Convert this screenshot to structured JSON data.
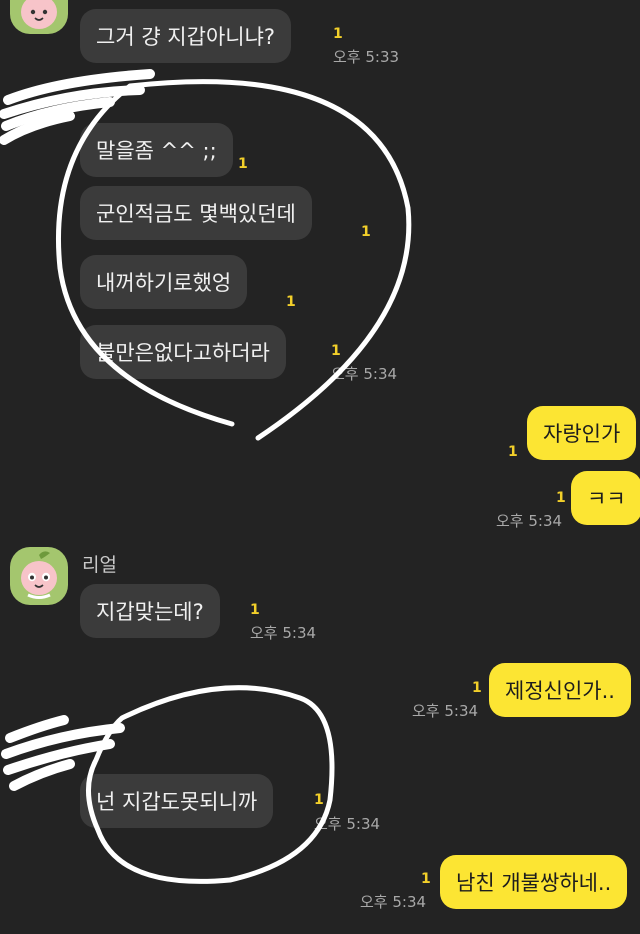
{
  "messages": {
    "m1": {
      "text": "그거 걍 지갑아니냐?",
      "unread": "1",
      "time": "오후 5:33"
    },
    "m2": {
      "text": "말을좀 ^^ ;;",
      "unread": "1"
    },
    "m3": {
      "text": "군인적금도 몇백있던데",
      "unread": "1"
    },
    "m4": {
      "text": "내꺼하기로했엉",
      "unread": "1"
    },
    "m5": {
      "text": "불만은없다고하더라",
      "unread": "1",
      "time": "오후 5:34"
    },
    "m6": {
      "text": "자랑인가",
      "unread": "1"
    },
    "m7": {
      "text": "ㅋㅋ",
      "unread": "1",
      "time": "오후 5:34"
    },
    "sender2": {
      "name": "리얼"
    },
    "m8": {
      "text": "지갑맞는데?",
      "unread": "1",
      "time": "오후 5:34"
    },
    "m9": {
      "text": "제정신인가..",
      "unread": "1",
      "time": "오후 5:34"
    },
    "m10": {
      "text": "넌 지갑도못되니까",
      "unread": "1",
      "time": "오후 5:34"
    },
    "m11": {
      "text": "남친 개불쌍하네..",
      "unread": "1",
      "time": "오후 5:34"
    }
  },
  "colors": {
    "background": "#232323",
    "received_bubble": "#3b3b3b",
    "sent_bubble": "#fce533",
    "unread": "#f2cf2a",
    "annotation": "#ffffff"
  },
  "icons": {
    "avatar": "peach-character-avatar"
  }
}
